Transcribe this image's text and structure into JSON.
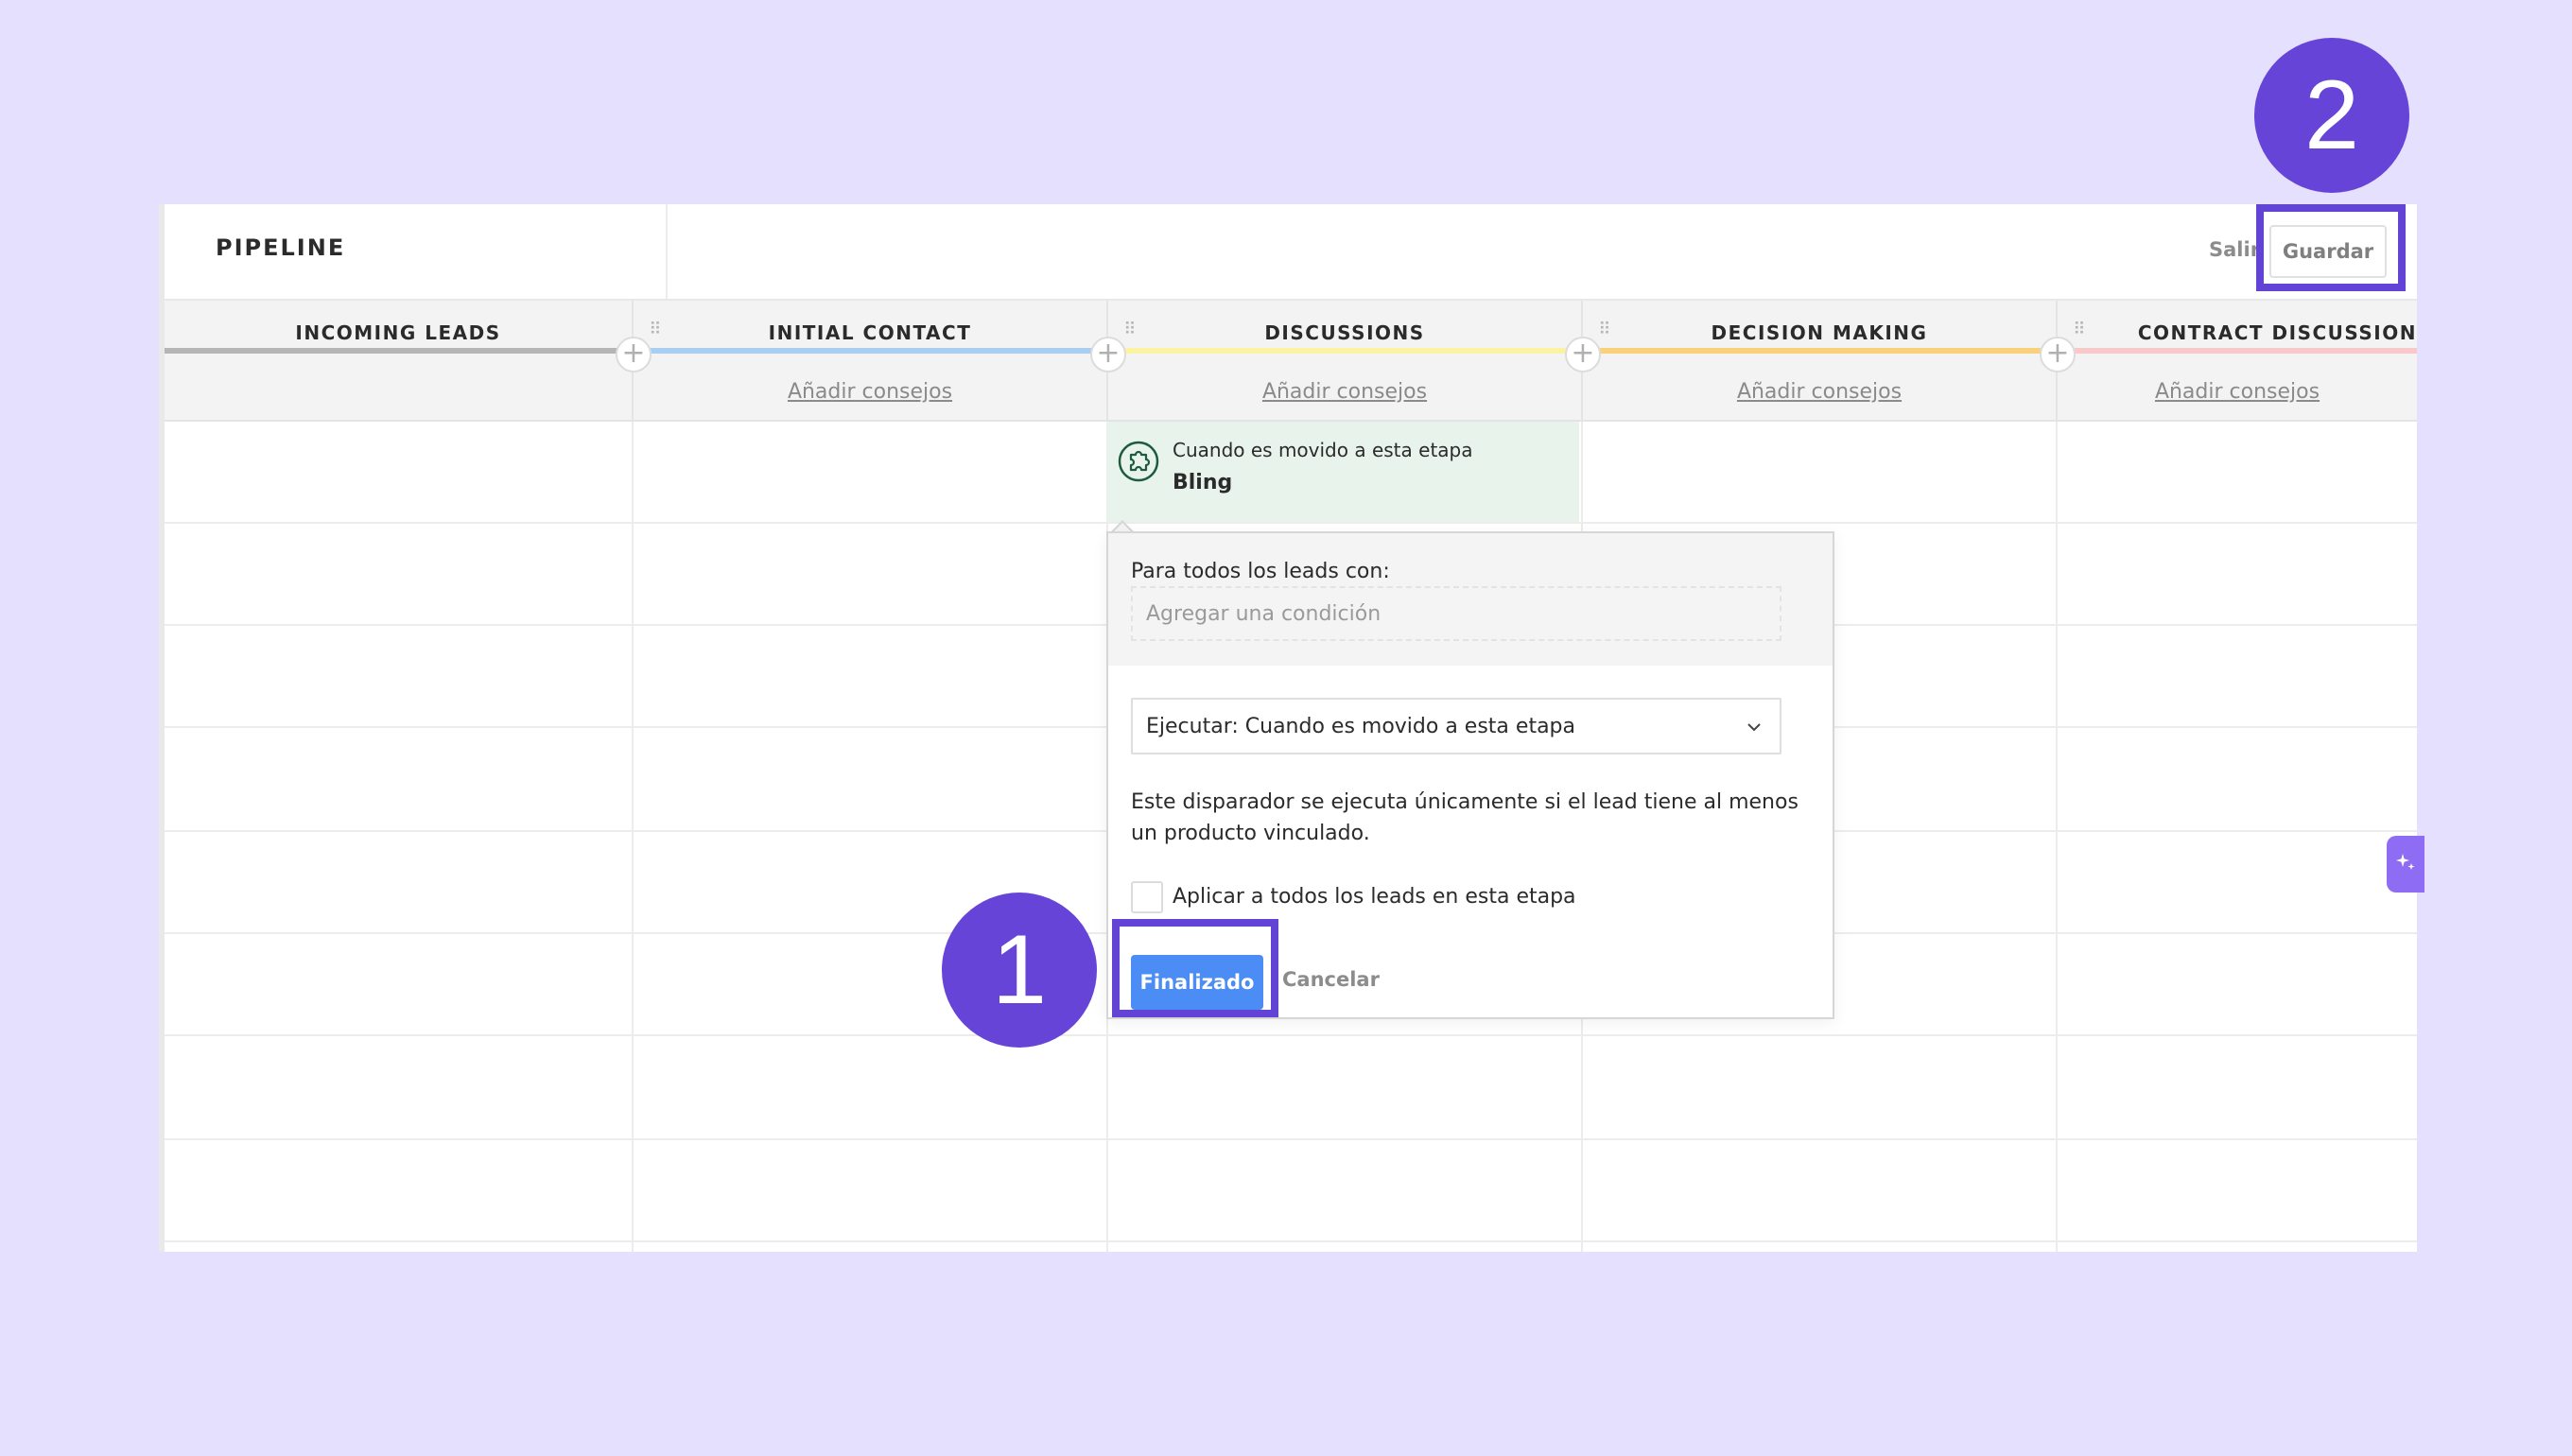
{
  "header": {
    "title": "PIPELINE",
    "exit_label": "Salir",
    "save_label": "Guardar"
  },
  "stages": [
    {
      "name": "INCOMING LEADS",
      "color": "#b5b5b5",
      "tips": ""
    },
    {
      "name": "INITIAL CONTACT",
      "color": "#a8cff2",
      "tips": "Añadir consejos"
    },
    {
      "name": "DISCUSSIONS",
      "color": "#fbf3a2",
      "tips": "Añadir consejos"
    },
    {
      "name": "DECISION MAKING",
      "color": "#f8d17a",
      "tips": "Añadir consejos"
    },
    {
      "name": "CONTRACT DISCUSSION",
      "color": "#f9c9c9",
      "tips": "Añadir consejos"
    }
  ],
  "trigger": {
    "label": "Cuando es movido a esta etapa",
    "name": "Bling",
    "icon": "bling-puzzle-icon"
  },
  "popover": {
    "condition_label": "Para todos los leads con:",
    "condition_placeholder": "Agregar una condición",
    "execute_value": "Ejecutar: Cuando es movido a esta etapa",
    "info": "Este disparador se ejecuta únicamente si el lead tiene al menos un producto vinculado.",
    "apply_all_label": "Aplicar a todos los leads en esta etapa",
    "apply_all_checked": false,
    "done_label": "Finalizado",
    "cancel_label": "Cancelar"
  },
  "annotations": {
    "step1": "1",
    "step2": "2",
    "color": "#6243d6"
  },
  "colors": {
    "background": "#e4e0fe",
    "primary_button": "#4c8df5",
    "trigger_bg": "#e7f3eb",
    "widget": "#8e6cf4"
  }
}
